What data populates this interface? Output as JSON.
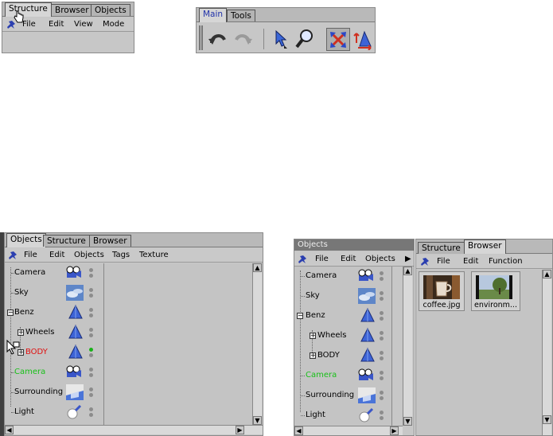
{
  "panel_a": {
    "tabs": [
      {
        "label": "Structure"
      },
      {
        "label": "Browser"
      },
      {
        "label": "Objects"
      }
    ],
    "menu": [
      {
        "label": "File"
      },
      {
        "label": "Edit"
      },
      {
        "label": "View"
      },
      {
        "label": "Mode"
      }
    ]
  },
  "toolbar": {
    "tabs": [
      {
        "label": "Main"
      },
      {
        "label": "Tools"
      }
    ],
    "icons": [
      "undo-icon",
      "redo-icon",
      "select-arrow-icon",
      "zoom-magnifier-icon",
      "scale-arrows-icon",
      "move-object-icon"
    ]
  },
  "panel_c": {
    "tabs": [
      {
        "label": "Objects"
      },
      {
        "label": "Structure"
      },
      {
        "label": "Browser"
      }
    ],
    "menu": [
      {
        "label": "File"
      },
      {
        "label": "Edit"
      },
      {
        "label": "Objects"
      },
      {
        "label": "Tags"
      },
      {
        "label": "Texture"
      }
    ],
    "rows": [
      {
        "label": "Camera",
        "color": "#000000",
        "icon": "camera-icon"
      },
      {
        "label": "Sky",
        "color": "#000000",
        "icon": "sky-icon"
      },
      {
        "label": "Benz",
        "color": "#000000",
        "icon": "polygon-icon"
      },
      {
        "label": "Wheels",
        "color": "#000000",
        "icon": "polygon-icon"
      },
      {
        "label": "BODY",
        "color": "#e01010",
        "icon": "polygon-icon"
      },
      {
        "label": "Camera",
        "color": "#19c019",
        "icon": "camera-icon"
      },
      {
        "label": "Surrounding",
        "color": "#000000",
        "icon": "floor-icon"
      },
      {
        "label": "Light",
        "color": "#000000",
        "icon": "light-icon"
      }
    ]
  },
  "panel_d": {
    "title": "Objects",
    "menu": [
      {
        "label": "File"
      },
      {
        "label": "Edit"
      },
      {
        "label": "Objects"
      }
    ],
    "rows": [
      {
        "label": "Camera",
        "color": "#000000"
      },
      {
        "label": "Sky",
        "color": "#000000"
      },
      {
        "label": "Benz",
        "color": "#000000"
      },
      {
        "label": "Wheels",
        "color": "#000000"
      },
      {
        "label": "BODY",
        "color": "#000000"
      },
      {
        "label": "Camera",
        "color": "#19c019"
      },
      {
        "label": "Surrounding",
        "color": "#000000"
      },
      {
        "label": "Light",
        "color": "#000000"
      }
    ]
  },
  "panel_e": {
    "tabs": [
      {
        "label": "Structure"
      },
      {
        "label": "Browser"
      }
    ],
    "menu": [
      {
        "label": "File"
      },
      {
        "label": "Edit"
      },
      {
        "label": "Function"
      }
    ],
    "files": [
      {
        "label": "coffee.jpg"
      },
      {
        "label": "environm..."
      }
    ]
  },
  "colors": {
    "panel": "#c7c7c7",
    "accent_tab": "#2233aa",
    "green": "#19c019",
    "red": "#e01010"
  }
}
